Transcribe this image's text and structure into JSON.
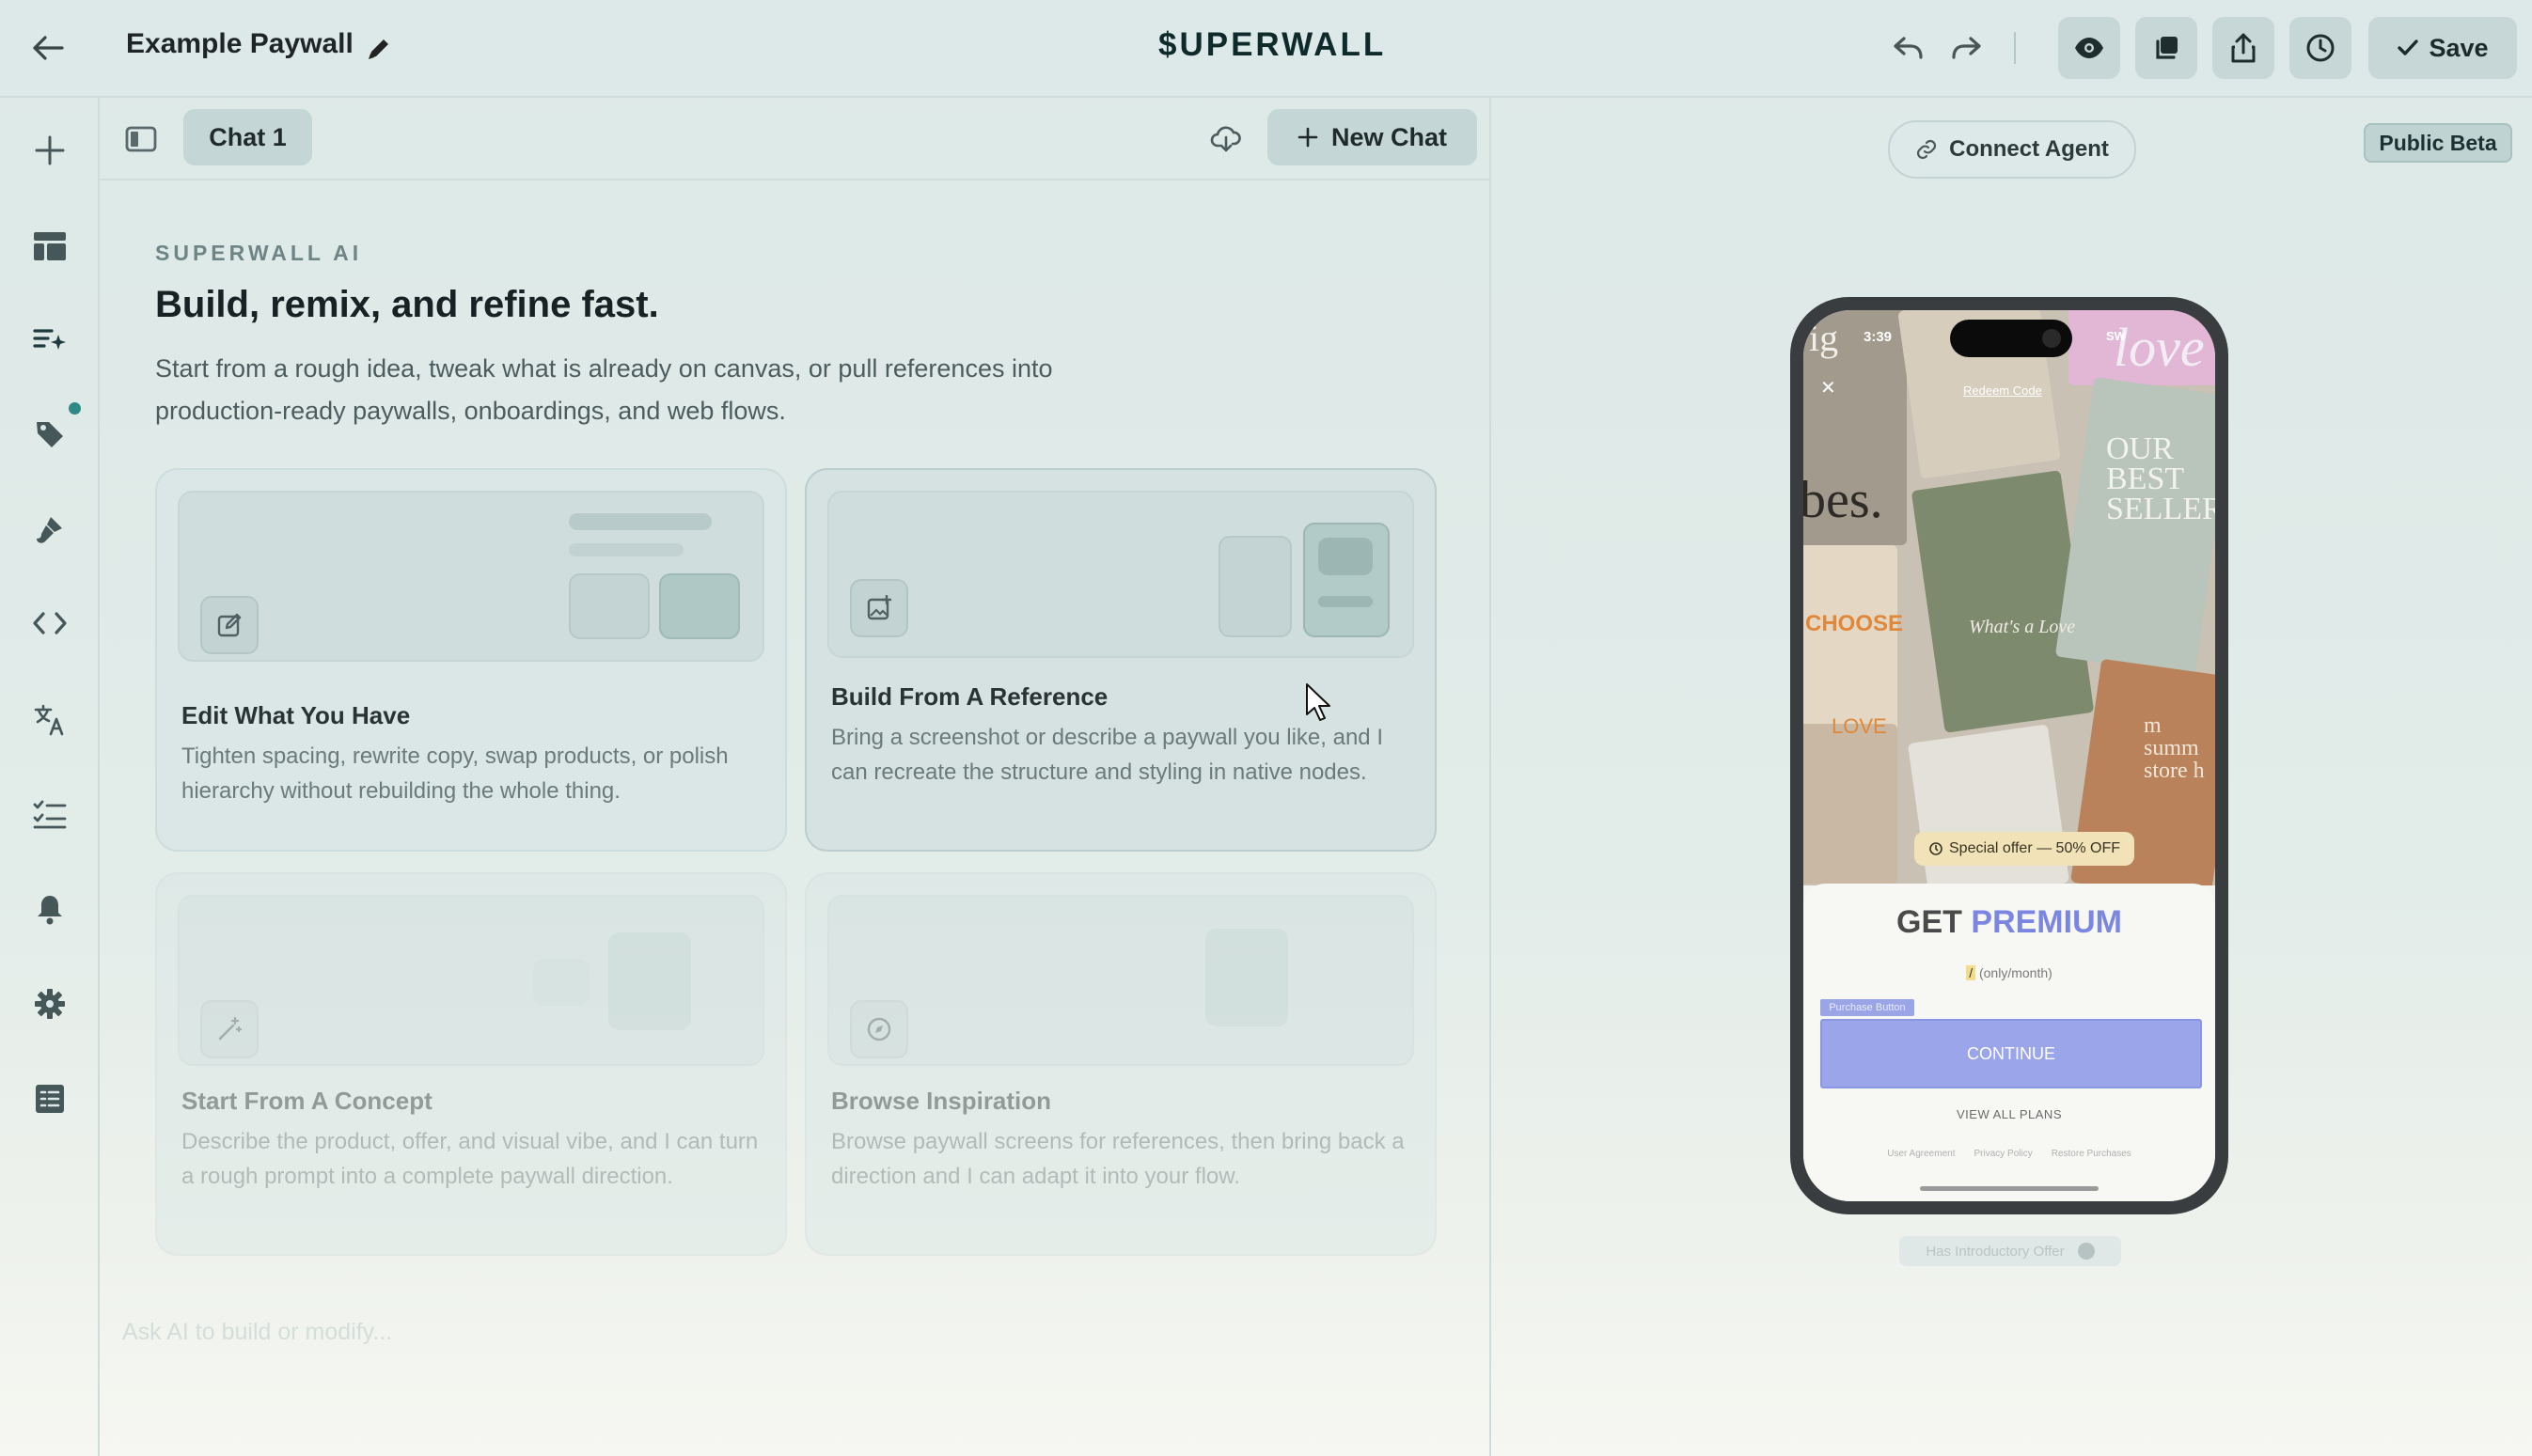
{
  "header": {
    "title": "Example Paywall",
    "logo": "$UPERWALL",
    "save_label": "Save"
  },
  "chat": {
    "tab_label": "Chat 1",
    "new_chat_label": "New Chat",
    "eyebrow": "SUPERWALL AI",
    "headline": "Build, remix, and refine fast.",
    "subtext": "Start from a rough idea, tweak what is already on canvas, or pull references into production-ready paywalls, onboardings, and web flows.",
    "cards": [
      {
        "title": "Edit What You Have",
        "desc": "Tighten spacing, rewrite copy, swap products, or polish hierarchy without rebuilding the whole thing.",
        "icon": "edit-icon"
      },
      {
        "title": "Build From A Reference",
        "desc": "Bring a screenshot or describe a paywall you like, and I can recreate the structure and styling in native nodes.",
        "icon": "image-plus-icon"
      },
      {
        "title": "Start From A Concept",
        "desc": "Describe the product, offer, and visual vibe, and I can turn a rough prompt into a complete paywall direction.",
        "icon": "magic-wand-icon"
      },
      {
        "title": "Browse Inspiration",
        "desc": "Browse paywall screens for references, then bring back a direction and I can adapt it into your flow.",
        "icon": "compass-icon"
      }
    ],
    "composer_placeholder": "Ask AI to build or modify..."
  },
  "preview": {
    "connect_label": "Connect Agent",
    "beta_label": "Public Beta",
    "phone": {
      "time": "3:39",
      "carrier": "SW",
      "redeem": "Redeem Code",
      "offer": "Special offer — 50% OFF",
      "get": "GET",
      "premium": "PREMIUM",
      "price_token": "/",
      "price_suffix": "(only/month)",
      "pb_label": "Purchase Button",
      "continue": "CONTINUE",
      "view_all": "VIEW ALL PLANS",
      "links": [
        "User Agreement",
        "Privacy Policy",
        "Restore Purchases"
      ],
      "collage_words": [
        "ig",
        "bes.",
        "love",
        "OUR BEST SELLER",
        "CHOOSE",
        "LOVE",
        "What's a Love",
        "m summ store h"
      ]
    },
    "intro_toggle_label": "Has Introductory Offer"
  },
  "colors": {
    "accent": "#2f8a86",
    "premium": "#7b86e2",
    "continue_bg": "#9aa5ea"
  }
}
